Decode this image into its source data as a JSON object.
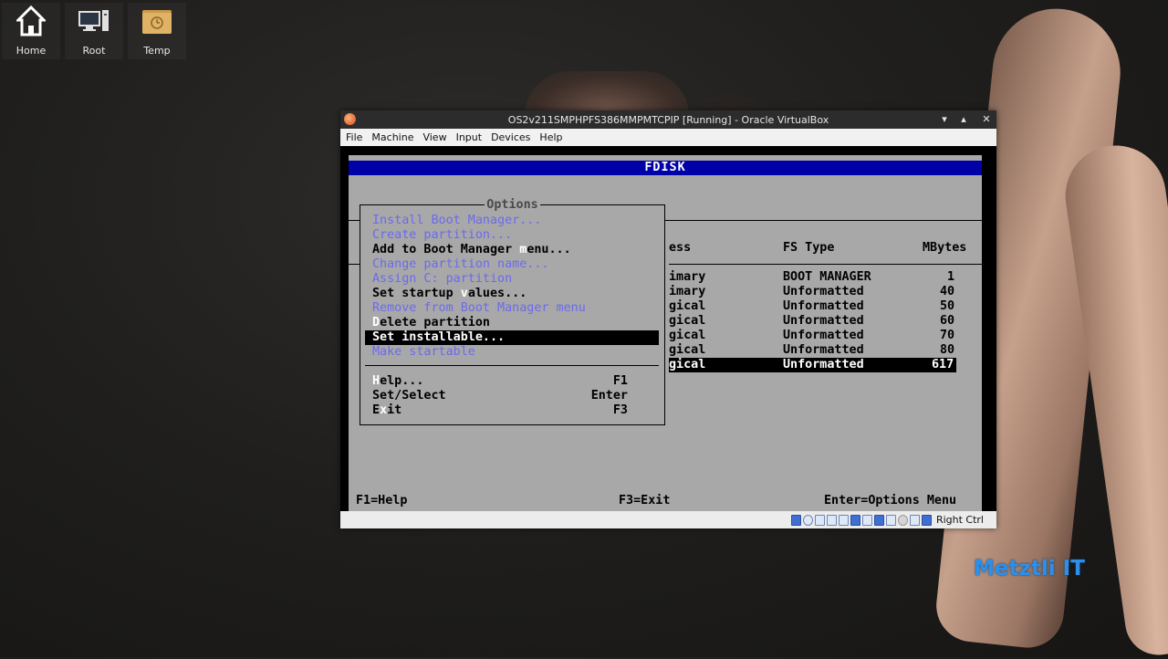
{
  "desktop": {
    "icons": [
      {
        "label": "Home",
        "icon": "home-icon"
      },
      {
        "label": "Root",
        "icon": "computer-icon"
      },
      {
        "label": "Temp",
        "icon": "folder-icon"
      }
    ],
    "watermark": "Metztli IT"
  },
  "window": {
    "title": "OS2v211SMPHPFS386MMPMTCPIP [Running] - Oracle VirtualBox",
    "controls": {
      "minimize": "▾",
      "maximize": "▴",
      "close": "✕"
    },
    "menu": [
      "File",
      "Machine",
      "View",
      "Input",
      "Devices",
      "Help"
    ],
    "status": {
      "host_key": "Right Ctrl"
    }
  },
  "fdisk": {
    "title": "FDISK",
    "options_title": "Options",
    "columns": {
      "access": "ess",
      "fs_type": "FS Type",
      "mbytes": "MBytes"
    },
    "partitions": [
      {
        "access": "imary",
        "fs_type": "BOOT MANAGER",
        "mbytes": "1"
      },
      {
        "access": "imary",
        "fs_type": "Unformatted",
        "mbytes": "40"
      },
      {
        "access": "gical",
        "fs_type": "Unformatted",
        "mbytes": "50"
      },
      {
        "access": "gical",
        "fs_type": "Unformatted",
        "mbytes": "60"
      },
      {
        "access": "gical",
        "fs_type": "Unformatted",
        "mbytes": "70"
      },
      {
        "access": "gical",
        "fs_type": "Unformatted",
        "mbytes": "80"
      },
      {
        "access": "gical",
        "fs_type": "Unformatted",
        "mbytes": "617"
      }
    ],
    "options": {
      "install_boot_manager": "Install Boot Manager...",
      "create_partition": "Create partition...",
      "add_boot_manager_pre": "Add to Boot Manager ",
      "add_boot_manager_hot": "m",
      "add_boot_manager_post": "enu...",
      "change_name": "Change partition name...",
      "assign_c": "Assign C: partition",
      "startup_pre": "Set startup ",
      "startup_hot": "v",
      "startup_post": "alues...",
      "remove_boot_manager": "Remove from Boot Manager menu",
      "delete_hot": "D",
      "delete_post": "elete partition",
      "set_installable": "Set installable...",
      "make_startable": "Make startable",
      "help_hot": "H",
      "help_post": "elp...",
      "help_key": "F1",
      "set_select": "Set/Select",
      "set_select_key": "Enter",
      "exit_pre": "E",
      "exit_hot": "x",
      "exit_post": "it",
      "exit_key": "F3"
    },
    "footer": {
      "help": "F1=Help",
      "exit": "F3=Exit",
      "options": "Enter=Options Menu"
    }
  }
}
